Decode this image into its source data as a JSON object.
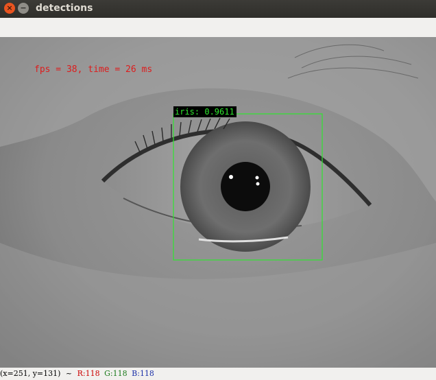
{
  "window": {
    "title": "detections",
    "close_glyph": "×",
    "minimize_glyph": "−"
  },
  "overlay": {
    "fps_text": "fps = 38, time = 26 ms",
    "fps_color": "#dd1c1c",
    "detection_label": "iris: 0.9611",
    "detection_color": "#2ee62e",
    "detection_label_bg": "#000000"
  },
  "statusbar": {
    "coords": "(x=251, y=131)",
    "separator": "~",
    "r_label": "R:",
    "r_value": "118",
    "g_label": "G:",
    "g_value": "118",
    "b_label": "B:",
    "b_value": "118",
    "r_color": "#cc0000",
    "g_color": "#1a7a1a",
    "b_color": "#1a2fa8"
  },
  "icons": {
    "close": "close-icon",
    "minimize": "minimize-icon"
  }
}
